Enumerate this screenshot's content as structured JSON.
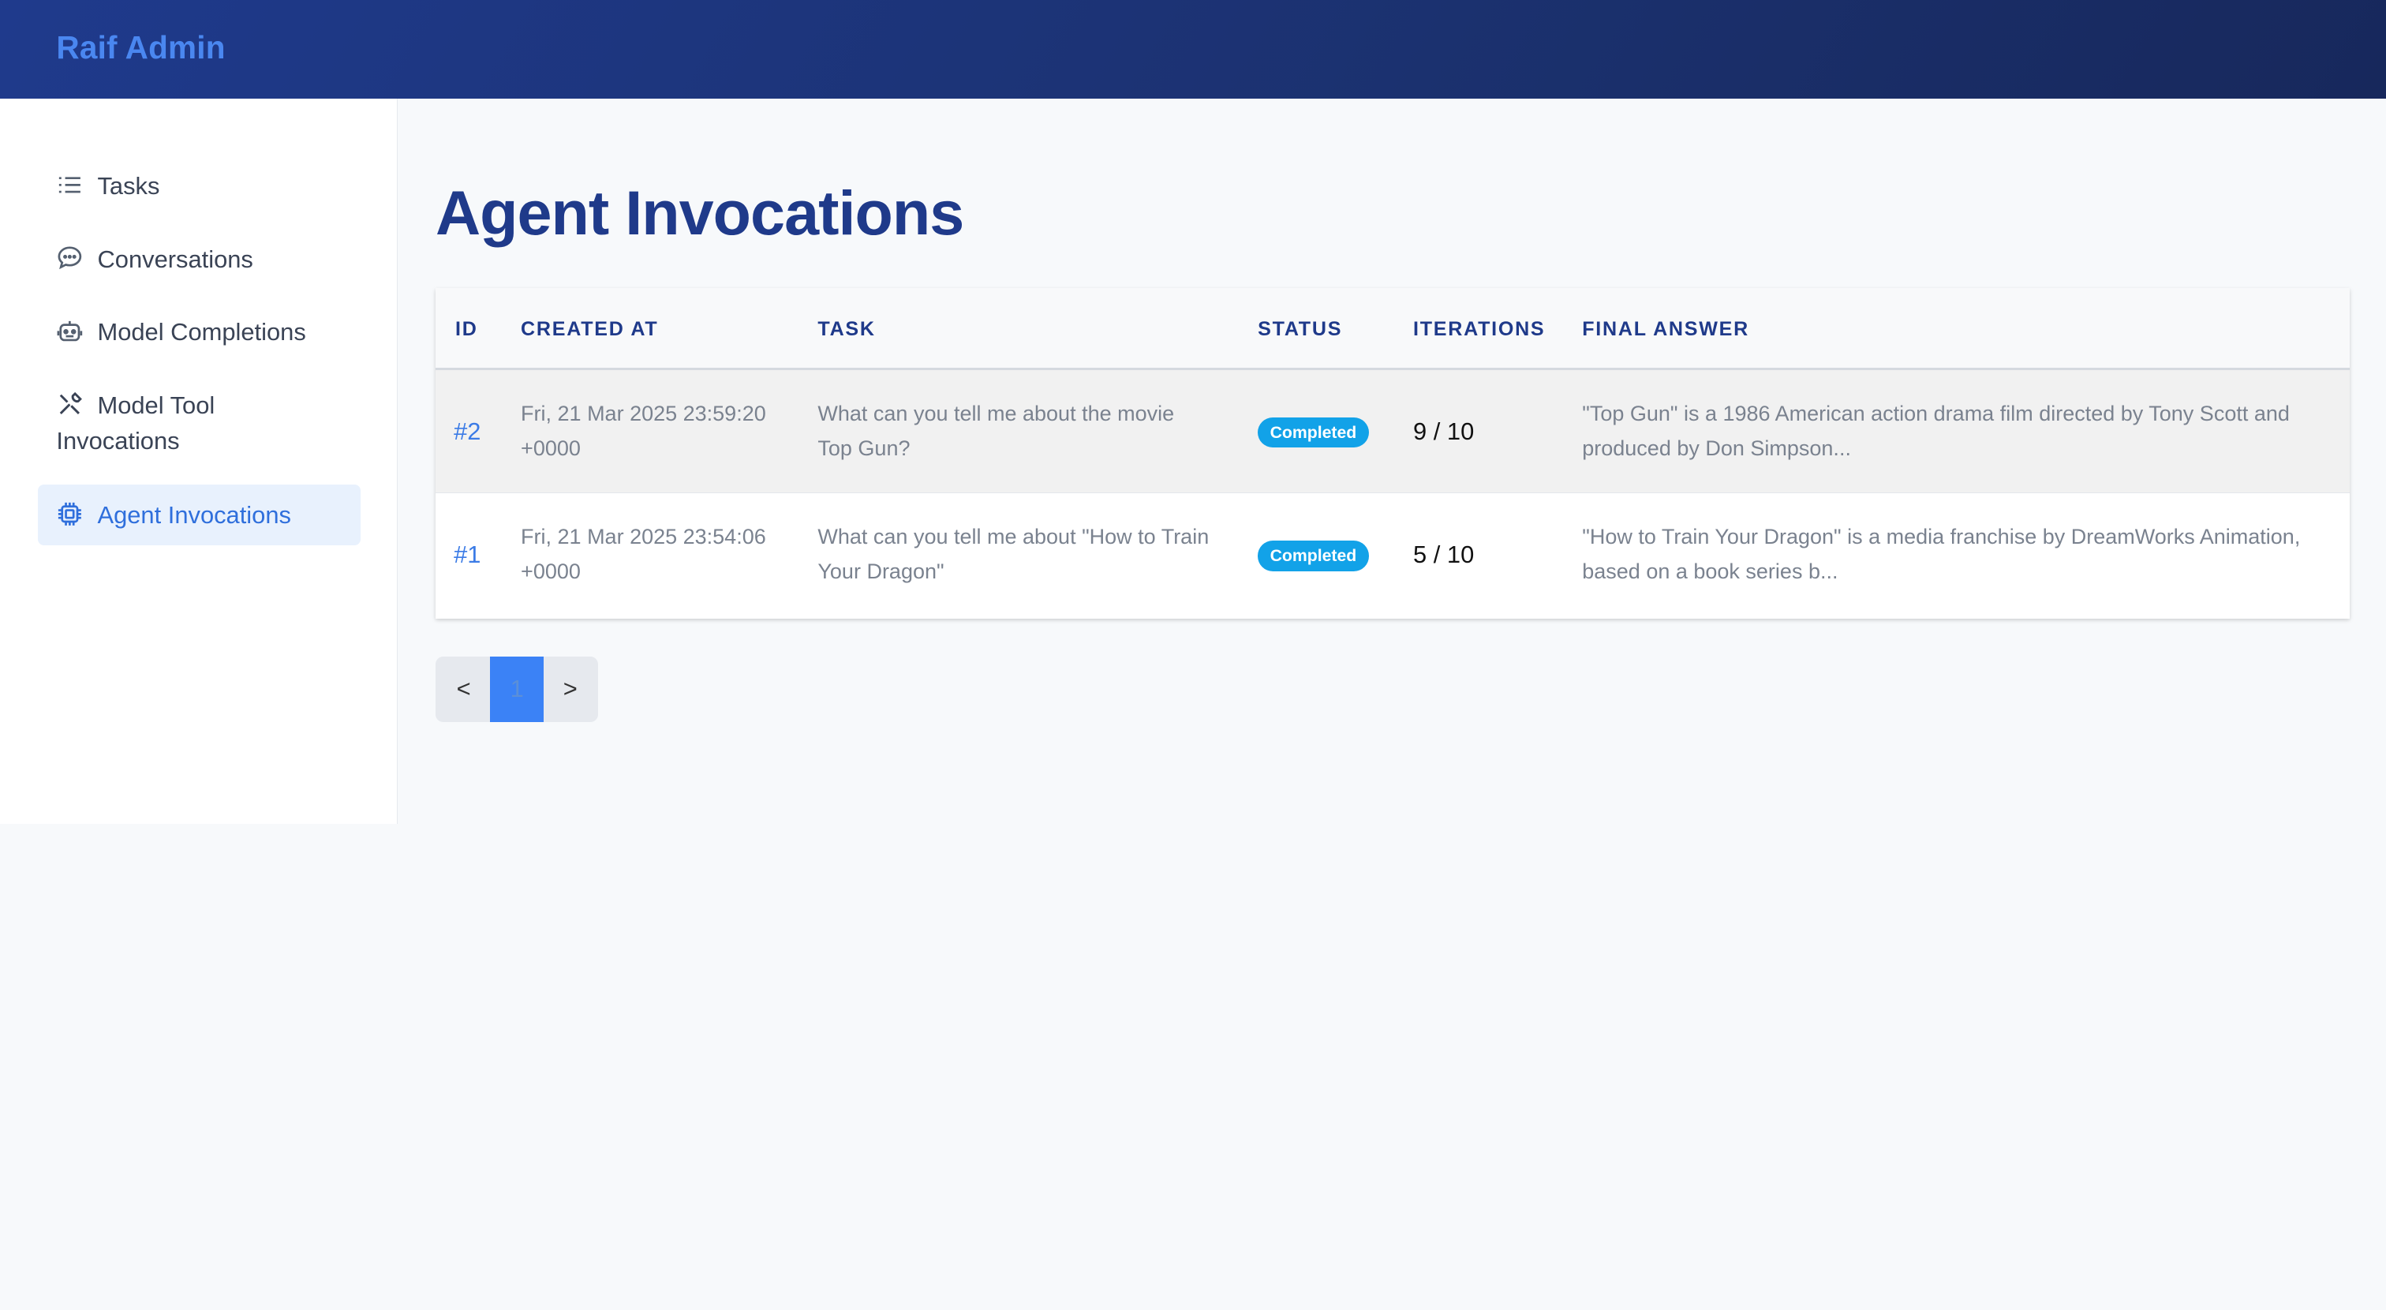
{
  "app": {
    "brand": "Raif Admin"
  },
  "sidebar": {
    "items": [
      {
        "label": "Tasks",
        "icon": "list-icon",
        "active": false
      },
      {
        "label": "Conversations",
        "icon": "chat-bubble-icon",
        "active": false
      },
      {
        "label": "Model Completions",
        "icon": "robot-icon",
        "active": false
      },
      {
        "label": "Model Tool Invocations",
        "label_line1": "Model Tool",
        "label_line2": "Invocations",
        "icon": "tools-icon",
        "active": false
      },
      {
        "label": "Agent Invocations",
        "icon": "chip-icon",
        "active": true
      }
    ]
  },
  "main": {
    "title": "Agent Invocations",
    "table": {
      "columns": [
        "ID",
        "CREATED AT",
        "TASK",
        "STATUS",
        "ITERATIONS",
        "FINAL ANSWER"
      ],
      "rows": [
        {
          "id": "#2",
          "created_line1": "Fri, 21 Mar 2025 23:59:20",
          "created_line2": "+0000",
          "task_line1": "What can you tell me about the movie",
          "task_line2": "Top Gun?",
          "status": "Completed",
          "iterations": "9 / 10",
          "answer_line1": "\"Top Gun\" is a 1986 American action drama film directed by Tony Scott and",
          "answer_line2": "produced by Don Simpson..."
        },
        {
          "id": "#1",
          "created_line1": "Fri, 21 Mar 2025 23:54:06",
          "created_line2": "+0000",
          "task_line1": "What can you tell me about \"How to Train",
          "task_line2": "Your Dragon\"",
          "status": "Completed",
          "iterations": "5 / 10",
          "answer_line1": "\"How to Train Your Dragon\" is a media franchise by DreamWorks Animation,",
          "answer_line2": "based on a book series b..."
        }
      ]
    },
    "pagination": {
      "prev": "<",
      "current": "1",
      "next": ">"
    }
  },
  "colors": {
    "header": "#1f3a8c",
    "brand": "#4a87f0",
    "title": "#1f3a8a",
    "badge": "#12a2e8",
    "active_nav_bg": "#e8f1fd",
    "link": "#3b7be6"
  }
}
